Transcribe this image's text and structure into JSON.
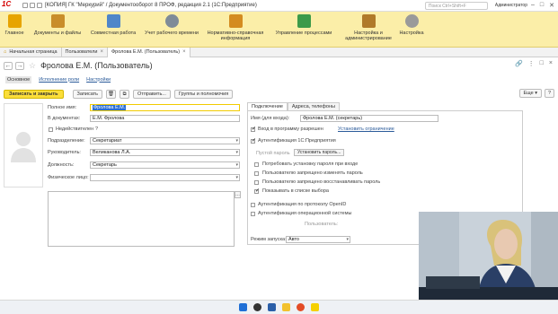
{
  "window": {
    "title": "[КОПИЯ] ГК \"Меркурий\" / Документооборот 8 ПРОФ, редакция 2.1  (1С:Предприятие)",
    "search_placeholder": "Поиск Ctrl+Shift+F",
    "user": "Администратор"
  },
  "ribbon": [
    {
      "label": "Главное",
      "color": "#e7a400"
    },
    {
      "label": "Документы и файлы",
      "color": "#c98d2a"
    },
    {
      "label": "Совместная работа",
      "color": "#4f86c9"
    },
    {
      "label": "Учет рабочего времени",
      "color": "#7f8b98"
    },
    {
      "label": "Нормативно-справочная информация",
      "color": "#d48b20"
    },
    {
      "label": "Управление процессами",
      "color": "#3c9a4a"
    },
    {
      "label": "Настройка и администрирование",
      "color": "#b07a2a"
    },
    {
      "label": "Настройка",
      "color": "#9a9a9a"
    }
  ],
  "tabs": [
    "Начальная страница",
    "Пользователи",
    "Фролова Е.М. (Пользователь)"
  ],
  "form": {
    "title": "Фролова Е.М. (Пользователь)",
    "subnav": {
      "main": "Основное",
      "roles": "Исполнение роли",
      "settings": "Настройки"
    },
    "toolbar": {
      "save_close": "Записать и закрыть",
      "save": "Записать",
      "send": "Отправить...",
      "groups": "Группы и полномочия",
      "more": "Еще"
    },
    "fields": {
      "fullname_label": "Полное имя:",
      "fullname": "Фролова Е.М.",
      "in_docs_label": "В документах:",
      "in_docs": "Е.М. Фролова",
      "invalid_label": "Недействителен",
      "dept_label": "Подразделение:",
      "dept": "Секретариат",
      "head_label": "Руководитель:",
      "head": "Великанова Л.А.",
      "position_label": "Должность:",
      "position": "Секретарь",
      "physical_label": "Физическое лицо:",
      "physical": ""
    },
    "right": {
      "tab_conn": "Подключение",
      "tab_addr": "Адреса, телефоны",
      "login_label": "Имя (для входа):",
      "login": "Фролова Е.М. (секретарь)",
      "allowed": "Вход в программу разрешен",
      "set_restriction": "Установить ограничение",
      "auth1c": "Аутентификация 1С:Предприятия",
      "empty_pwd": "Пустой пароль",
      "set_pwd": "Установить пароль...",
      "cb1": "Потребовать установку пароля при входе",
      "cb2": "Пользователю запрещено изменять пароль",
      "cb3": "Пользователю запрещено восстанавливать пароль",
      "cb4": "Показывать в списке выбора",
      "openid": "Аутентификация по протоколу OpenID",
      "os_auth": "Аутентификация операционной системы",
      "user_label": "Пользователь:",
      "run_mode_label": "Режим запуска:",
      "run_mode": "Авто"
    }
  }
}
